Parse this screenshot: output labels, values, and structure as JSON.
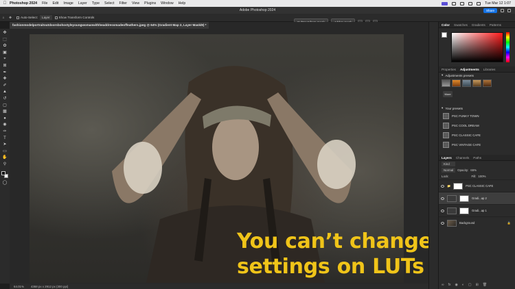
{
  "menubar": {
    "apple": "",
    "app_name": "Photoshop 2024",
    "items": [
      "File",
      "Edit",
      "Image",
      "Layer",
      "Type",
      "Select",
      "Filter",
      "View",
      "Plugins",
      "Window",
      "Help"
    ],
    "datetime": "Tue Mar 12  1:07"
  },
  "titlebar": {
    "title": "Adobe Photoshop 2024",
    "share": "Share"
  },
  "options": {
    "tool_icon": "move-icon",
    "auto_select": "Auto-Select:",
    "auto_select_value": "Layer",
    "transform": "Show Transform Controls",
    "subtract_mask": "Subtract from mask",
    "add_mask": "Add to mask"
  },
  "document": {
    "tab_title": "fashionmodelportraitoutdoorsbohostyleyoungwomanwithheaddressmadeoffeathers.jpeg @ 64% (Gradient Map 2, Layer Mask/8) *",
    "overlay_line1": "You can’t change",
    "overlay_line2": "settings on LUTs"
  },
  "status": {
    "zoom": "64.01%",
    "dims": "4368 px x 2912 px (300 ppi)"
  },
  "panels": {
    "color_tabs": [
      "Color",
      "Swatches",
      "Gradients",
      "Patterns"
    ],
    "adj_tabs": [
      "Properties",
      "Adjustments",
      "Libraries"
    ],
    "adjustment_presets": "Adjustments presets",
    "new_label": "More",
    "your_presets": "Your presets",
    "presets": [
      "PSC FUNKY TOWN",
      "PSC COOL DREAM",
      "PSC CLASSIC CAFE",
      "PSC VINTAGE CAFE"
    ],
    "layer_tabs": [
      "Layers",
      "Channels",
      "Paths"
    ],
    "kind": "Kind",
    "blend": "Normal",
    "opacity_label": "Opacity:",
    "opacity": "65%",
    "lock_label": "Lock:",
    "fill_label": "Fill:",
    "fill": "100%",
    "layers": [
      {
        "name": "PSC CLASSIC CAFE",
        "thumb": "white"
      },
      {
        "name": "Gradi...ap 2",
        "thumb": "adj"
      },
      {
        "name": "Gradi...ap 1",
        "thumb": "adj"
      },
      {
        "name": "Background",
        "thumb": "photo"
      }
    ]
  },
  "colors": {
    "accent": "#1473e6",
    "overlay_text": "#f0c419"
  }
}
